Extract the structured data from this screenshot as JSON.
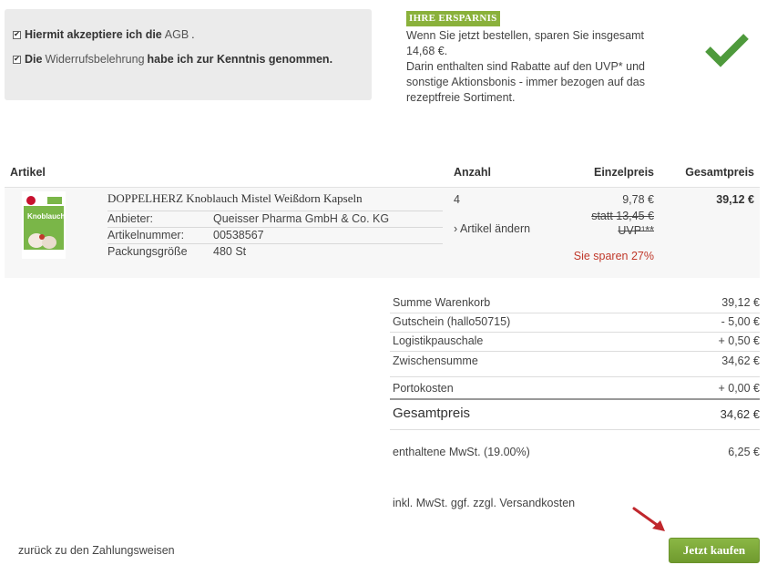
{
  "consent": {
    "row1": {
      "bold_text": "Hiermit akzeptiere ich die",
      "link": "AGB",
      "tail": "."
    },
    "row2": {
      "bold_start": "Die",
      "link": "Widerrufsbelehrung",
      "bold_end": "habe ich zur Kenntnis genommen."
    }
  },
  "savings": {
    "tag": "IHRE ERSPARNIS",
    "line1": "Wenn Sie jetzt bestellen, sparen Sie insgesamt 14,68 €.",
    "line2": "Darin enthalten sind Rabatte auf den UVP* und sonstige Aktionsbonis - immer bezogen auf das rezeptfreie Sortiment."
  },
  "table": {
    "headers": {
      "article": "Artikel",
      "qty": "Anzahl",
      "unit_price": "Einzelpreis",
      "total": "Gesamtpreis"
    },
    "item": {
      "name": "DOPPELHERZ Knoblauch Mistel Weißdorn Kapseln",
      "thumb_label": "Knoblauch",
      "attributes": [
        {
          "key": "Anbieter:",
          "value": "Queisser Pharma GmbH & Co. KG"
        },
        {
          "key": "Artikelnummer:",
          "value": "00538567"
        },
        {
          "key": "Packungsgröße",
          "value": "480 St"
        }
      ],
      "qty": "4",
      "change_link": "› Artikel ändern",
      "unit_price": "9,78 €",
      "statt": "statt 13,45 €",
      "uvp": "UVP¹**",
      "save": "Sie sparen 27%",
      "total": "39,12 €"
    }
  },
  "summary": {
    "rows": [
      {
        "label": "Summe Warenkorb",
        "value": "39,12 €"
      },
      {
        "label": "Gutschein (hallo50715)",
        "value": "- 5,00 €"
      },
      {
        "label": "Logistikpauschale",
        "value": "+ 0,50 €"
      },
      {
        "label": "Zwischensumme",
        "value": "34,62 €"
      },
      {
        "label": "Portokosten",
        "value": "+ 0,00 €"
      }
    ],
    "grand": {
      "label": "Gesamtpreis",
      "value": "34,62 €"
    },
    "vat": {
      "label": "enthaltene MwSt. (19.00%)",
      "value": "6,25 €"
    },
    "note": "inkl. MwSt. ggf. zzgl. Versandkosten"
  },
  "footer": {
    "back_link": "zurück zu den Zahlungsweisen",
    "buy_button": "Jetzt kaufen"
  },
  "colors": {
    "accent_green": "#7aa33a",
    "savings_red": "#c0392b",
    "check_green": "#4e9a3c"
  }
}
